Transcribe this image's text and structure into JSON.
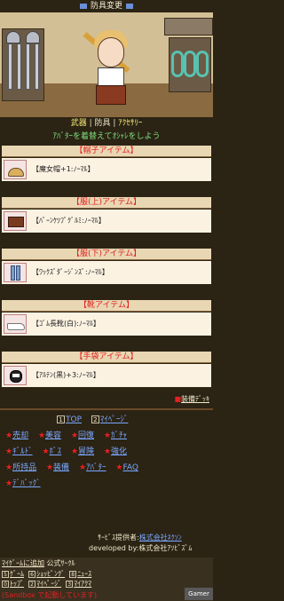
{
  "title": "防具変更",
  "tabs": {
    "weapon": "武器",
    "sep1": " | ",
    "armor": "防具",
    "sep2": " | ",
    "accessory": "ｱｸｾｻﾘｰ"
  },
  "message": "ｱﾊﾞﾀｰを着替えてｵｼｬﾚをしよう",
  "sections": [
    {
      "header": "【帽子アイテム】",
      "item": "【魔女帽+1:ﾉｰﾏﾙ】"
    },
    {
      "header": "【服(上)アイテム】",
      "item": "【ﾊﾟｰﾝｹﾂﾌﾟｸﾞﾙﾐ:ﾉｰﾏﾙ】"
    },
    {
      "header": "【服(下)アイテム】",
      "item": "【ﾜｯｸｽﾞﾀﾞｰｼﾞﾝｽﾞ:ﾉｰﾏﾙ】"
    },
    {
      "header": "【靴アイテム】",
      "item": "【ｺﾞﾑ長靴(白):ﾉｰﾏﾙ】"
    },
    {
      "header": "【手袋アイテム】",
      "item": "【ｱﾙﾃﾝ(黒)+3:ﾉｰﾏﾙ】"
    }
  ],
  "equip_deck": {
    "prefix": "■",
    "label": "装備ﾃﾞｯｷ"
  },
  "menu": {
    "row0": [
      {
        "num": "1",
        "label": "TOP"
      },
      {
        "num": "2",
        "label": "ﾏｲﾍﾟｰｼﾞ"
      }
    ],
    "row1": [
      "売却",
      "美容",
      "回復",
      "ｶﾞﾁｬ"
    ],
    "row2": [
      "ｷﾞﾙﾄﾞ",
      "ﾎﾞｽ",
      "冒険",
      "強化"
    ],
    "row3": [
      "所持品",
      "装備",
      "ｱﾊﾞﾀｰ",
      "FAQ"
    ],
    "row4": [
      "ﾃﾞﾊﾞｯｸﾞ"
    ],
    "star": "★"
  },
  "provider": {
    "label": "ｻｰﾋﾞｽ提供者:",
    "company": "株式会社ﾈｸｿﾝ"
  },
  "developed": "developed by:株式会社ｱｿﾋﾞｽﾞﾑ",
  "footer": {
    "add_label": "ﾏｲｹﾞｰﾑに追加",
    "official": "公式ｻｰｸﾙ",
    "links": [
      {
        "num": "5",
        "label": "ｹﾞｰﾑ"
      },
      {
        "num": "6",
        "label": "ｼｮｯﾋﾟﾝｸﾞ"
      },
      {
        "num": "8",
        "label": "ﾆｭｰｽ"
      },
      {
        "num": "0",
        "label": "ﾄｯﾌﾟ"
      },
      {
        "num": "2",
        "label": "ﾏｲﾍﾟｰｼﾞ"
      },
      {
        "num": "3",
        "label": "ﾏｲｱｸﾏ"
      }
    ],
    "sandbox": "(Sandbox で起動しています)"
  },
  "watermark": "Gamer"
}
